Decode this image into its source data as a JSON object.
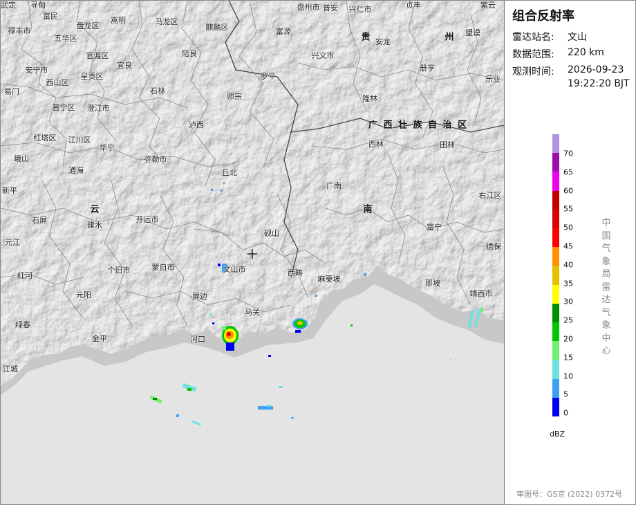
{
  "panel": {
    "title": "组合反射率",
    "station_label": "雷达站名:",
    "station_value": "文山",
    "range_label": "数据范围:",
    "range_value": "220 km",
    "time_label": "观测时间:",
    "time_date": "2026-09-23",
    "time_clock": "19:22:20 BJT",
    "legend_unit": "dBZ",
    "organization": "中国气象局雷达气象中心",
    "approval": "审图号：GS京 (2022) 0372号"
  },
  "legend": {
    "ticks": [
      "70",
      "65",
      "60",
      "55",
      "50",
      "45",
      "40",
      "35",
      "30",
      "25",
      "20",
      "15",
      "10",
      "5",
      "0"
    ],
    "colors": [
      "#b092e0",
      "#9c10aa",
      "#f000f0",
      "#c00000",
      "#d80000",
      "#ff0000",
      "#ff9000",
      "#e8c000",
      "#ffff00",
      "#009000",
      "#00c800",
      "#70f070",
      "#70e0e0",
      "#40a0f0",
      "#0000f0"
    ]
  },
  "map": {
    "places": [
      {
        "n": "武定"
      },
      {
        "n": "寻甸"
      },
      {
        "n": "富民"
      },
      {
        "n": "嵩明"
      },
      {
        "n": "马龙区"
      },
      {
        "n": "盘龙区"
      },
      {
        "n": "禄丰市"
      },
      {
        "n": "五华区"
      },
      {
        "n": "麒麟区"
      },
      {
        "n": "富源"
      },
      {
        "n": "盘州市"
      },
      {
        "n": "普安"
      },
      {
        "n": "兴仁市"
      },
      {
        "n": "贞丰"
      },
      {
        "n": "紫云"
      },
      {
        "n": "安龙"
      },
      {
        "n": "望谟"
      },
      {
        "n": "官渡区"
      },
      {
        "n": "陆良"
      },
      {
        "n": "兴义市"
      },
      {
        "n": "安宁市"
      },
      {
        "n": "呈贡区"
      },
      {
        "n": "宜良"
      },
      {
        "n": "罗平"
      },
      {
        "n": "册亨"
      },
      {
        "n": "乐业"
      },
      {
        "n": "易门"
      },
      {
        "n": "西山区"
      },
      {
        "n": "石林"
      },
      {
        "n": "师宗"
      },
      {
        "n": "隆林"
      },
      {
        "n": "晋宁区"
      },
      {
        "n": "澄江市"
      },
      {
        "n": "泸西"
      },
      {
        "n": "西林"
      },
      {
        "n": "田林"
      },
      {
        "n": "红塔区"
      },
      {
        "n": "江川区"
      },
      {
        "n": "华宁"
      },
      {
        "n": "峨山"
      },
      {
        "n": "弥勒市"
      },
      {
        "n": "通海"
      },
      {
        "n": "丘北"
      },
      {
        "n": "广南"
      },
      {
        "n": "新平"
      },
      {
        "n": "右江区"
      },
      {
        "n": "石屏"
      },
      {
        "n": "建水"
      },
      {
        "n": "开远市"
      },
      {
        "n": "砚山"
      },
      {
        "n": "富宁"
      },
      {
        "n": "元江"
      },
      {
        "n": "德保"
      },
      {
        "n": "个旧市"
      },
      {
        "n": "蒙自市"
      },
      {
        "n": "文山市"
      },
      {
        "n": "西畴"
      },
      {
        "n": "麻栗坡"
      },
      {
        "n": "红河"
      },
      {
        "n": "那坡"
      },
      {
        "n": "元阳"
      },
      {
        "n": "屏边"
      },
      {
        "n": "靖西市"
      },
      {
        "n": "马关"
      },
      {
        "n": "绿春"
      },
      {
        "n": "河口"
      },
      {
        "n": "金平"
      },
      {
        "n": "江城"
      }
    ],
    "regions": [
      {
        "n": "贵"
      },
      {
        "n": "州"
      },
      {
        "n": "广 西 壮 族 自 治 区"
      },
      {
        "n": "云"
      },
      {
        "n": "南"
      }
    ]
  }
}
